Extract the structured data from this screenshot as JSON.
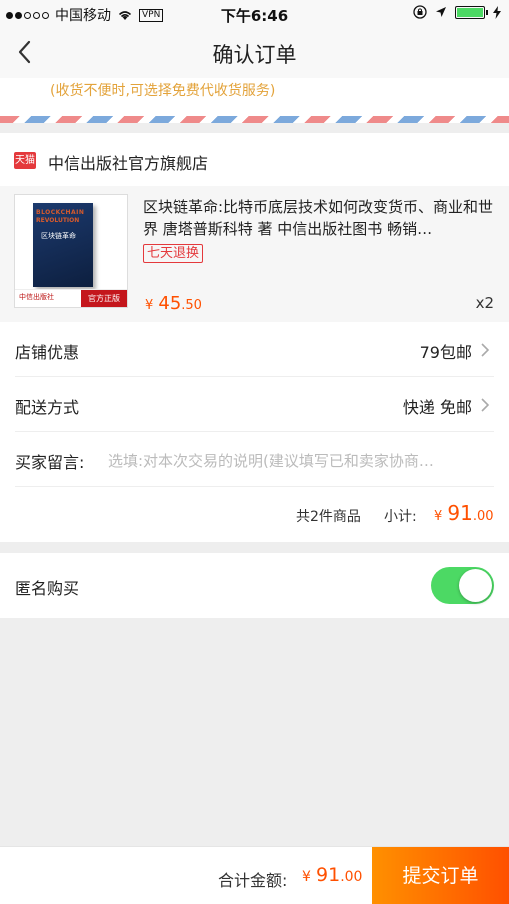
{
  "status_bar": {
    "carrier": "中国移动",
    "vpn": "VPN",
    "time": "下午6:46"
  },
  "nav": {
    "title": "确认订单"
  },
  "address": {
    "notice": "(收货不便时,可选择免费代收货服务)"
  },
  "shop": {
    "badge": "天猫",
    "name": "中信出版社官方旗舰店"
  },
  "product": {
    "title": "区块链革命:比特币底层技术如何改变货币、商业和世界 唐塔普斯科特 著 中信出版社图书 畅销…",
    "cover": {
      "line1": "BLOCKCHAIN",
      "line2": "REVOLUTION",
      "line3": "区块链革命",
      "publisher": "中信出版社",
      "official": "官方正版"
    },
    "return_tag": "七天退换",
    "price_symbol": "¥",
    "price_int": "45",
    "price_dec": ".50",
    "quantity": "x2"
  },
  "options": {
    "discount_label": "店铺优惠",
    "discount_value": "79包邮",
    "delivery_label": "配送方式",
    "delivery_value": "快递 免邮",
    "message_label": "买家留言:",
    "message_placeholder": "选填:对本次交易的说明(建议填写已和卖家协商…"
  },
  "summary": {
    "items": "共2件商品",
    "subtotal_label": "小计:",
    "price_symbol": "¥",
    "price_int": "91",
    "price_dec": ".00"
  },
  "anonymous": {
    "label": "匿名购买",
    "enabled": true
  },
  "footer": {
    "total_label": "合计金额:",
    "price_symbol": "¥",
    "price_int": "91",
    "price_dec": ".00",
    "submit_label": "提交订单"
  },
  "colors": {
    "accent": "#ff5000",
    "toggle_on": "#4cd964",
    "notice": "#e3a33b"
  }
}
